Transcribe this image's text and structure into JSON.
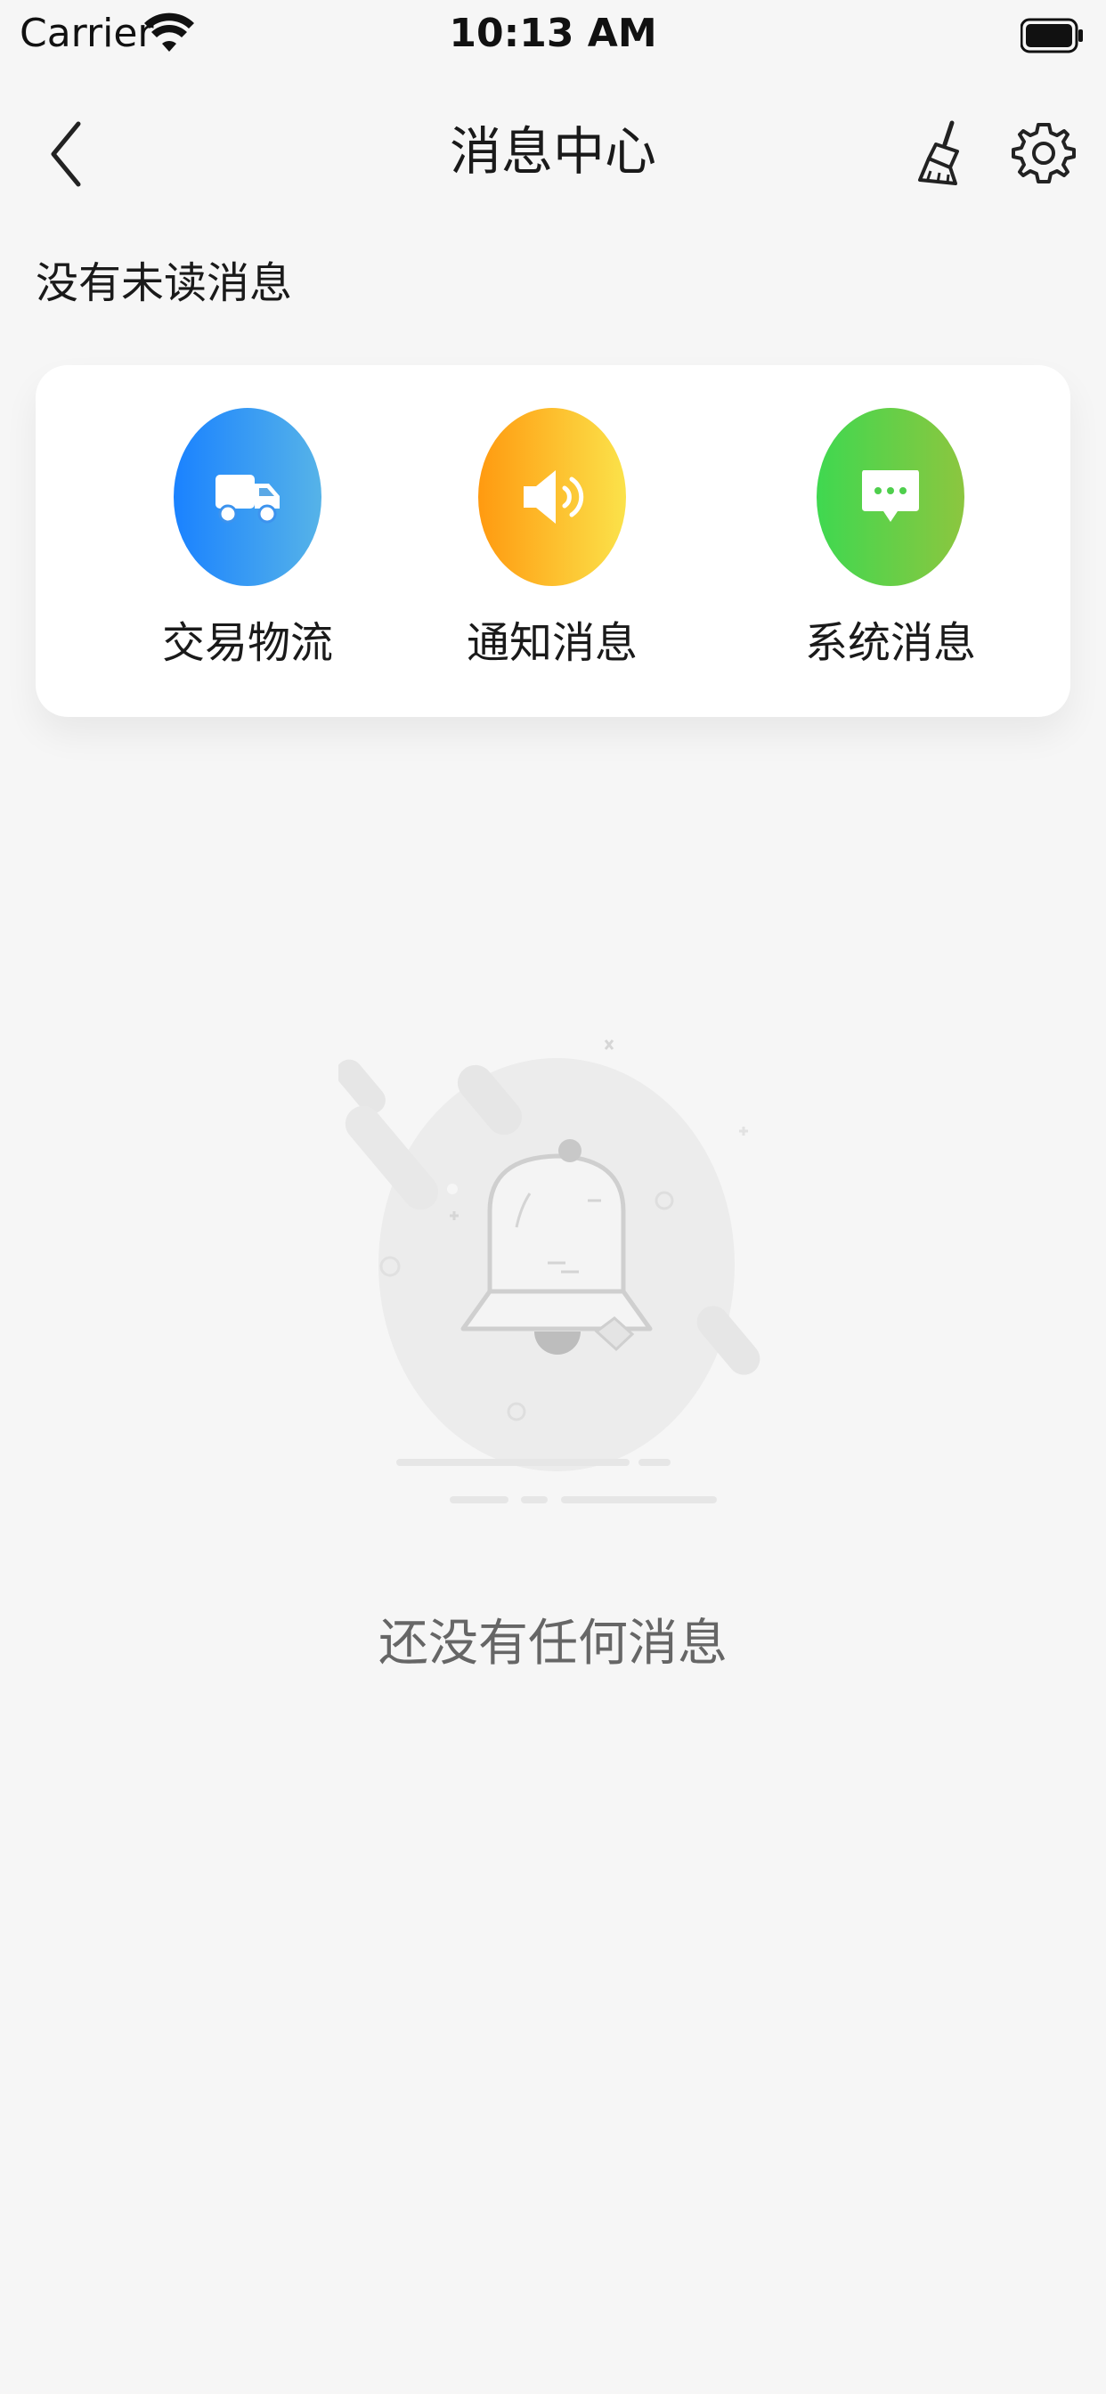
{
  "status_bar": {
    "carrier": "Carrier",
    "time": "10:13 AM"
  },
  "nav": {
    "title": "消息中心",
    "back_icon": "chevron-left-icon",
    "clean_icon": "broom-icon",
    "settings_icon": "gear-icon"
  },
  "unread_status": "没有未读消息",
  "categories": [
    {
      "label": "交易物流",
      "icon": "truck-icon",
      "colors": [
        "#1a82ff",
        "#56b3e8"
      ]
    },
    {
      "label": "通知消息",
      "icon": "speaker-icon",
      "colors": [
        "#ff9a10",
        "#fbe24a"
      ]
    },
    {
      "label": "系统消息",
      "icon": "chat-bubble-icon",
      "colors": [
        "#3fd850",
        "#8cc63f"
      ]
    }
  ],
  "empty_state": {
    "icon": "bell-icon",
    "text": "还没有任何消息"
  }
}
